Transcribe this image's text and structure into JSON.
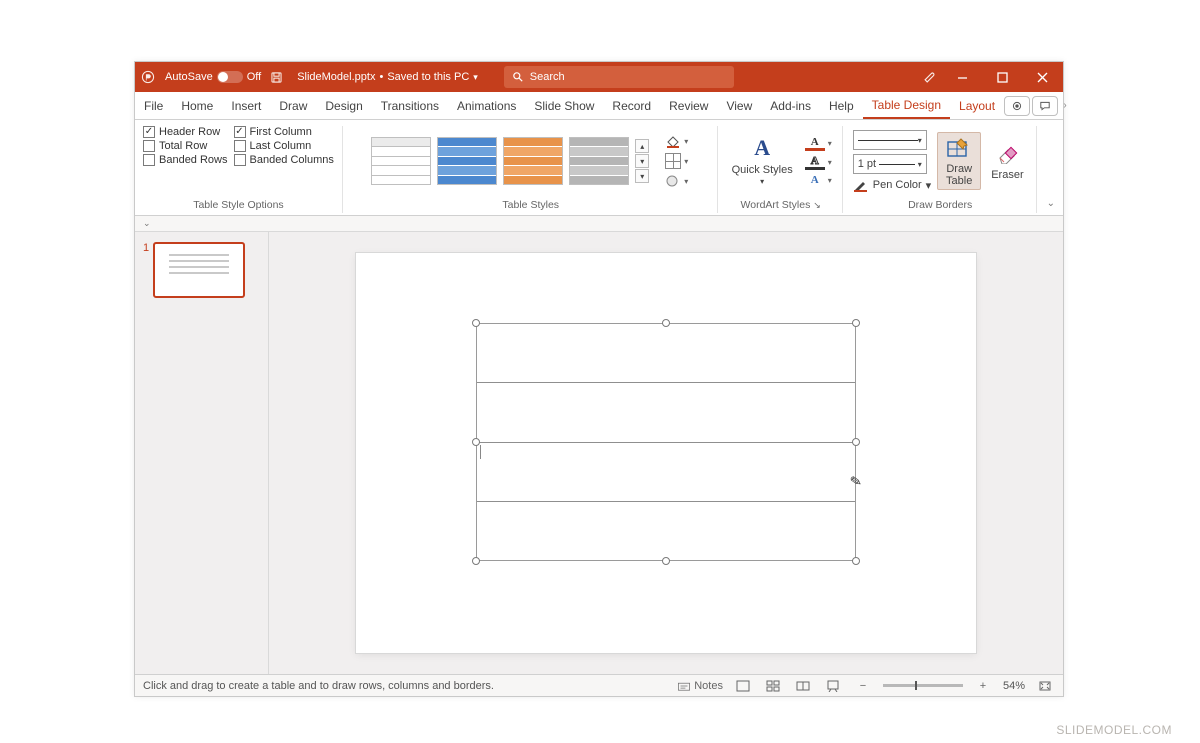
{
  "titlebar": {
    "autosave_label": "AutoSave",
    "autosave_state": "Off",
    "filename": "SlideModel.pptx",
    "save_status": "Saved to this PC",
    "search_placeholder": "Search"
  },
  "tabs": {
    "file": "File",
    "home": "Home",
    "insert": "Insert",
    "draw": "Draw",
    "design": "Design",
    "transitions": "Transitions",
    "animations": "Animations",
    "slideshow": "Slide Show",
    "record": "Record",
    "review": "Review",
    "view": "View",
    "addins": "Add-ins",
    "help": "Help",
    "table_design": "Table Design",
    "layout": "Layout"
  },
  "ribbon": {
    "style_options": {
      "header_row": "Header Row",
      "first_column": "First Column",
      "total_row": "Total Row",
      "last_column": "Last Column",
      "banded_rows": "Banded Rows",
      "banded_columns": "Banded Columns",
      "group_label": "Table Style Options"
    },
    "table_styles": {
      "group_label": "Table Styles"
    },
    "wordart": {
      "quick_styles": "Quick Styles",
      "group_label": "WordArt Styles"
    },
    "borders": {
      "pen_weight": "1 pt",
      "pen_color": "Pen Color",
      "draw_table": "Draw Table",
      "eraser": "Eraser",
      "group_label": "Draw Borders"
    }
  },
  "thumb": {
    "number": "1"
  },
  "statusbar": {
    "hint": "Click and drag to create a table and to draw rows, columns and borders.",
    "notes": "Notes",
    "zoom": "54%"
  },
  "watermark": "SLIDEMODEL.COM"
}
